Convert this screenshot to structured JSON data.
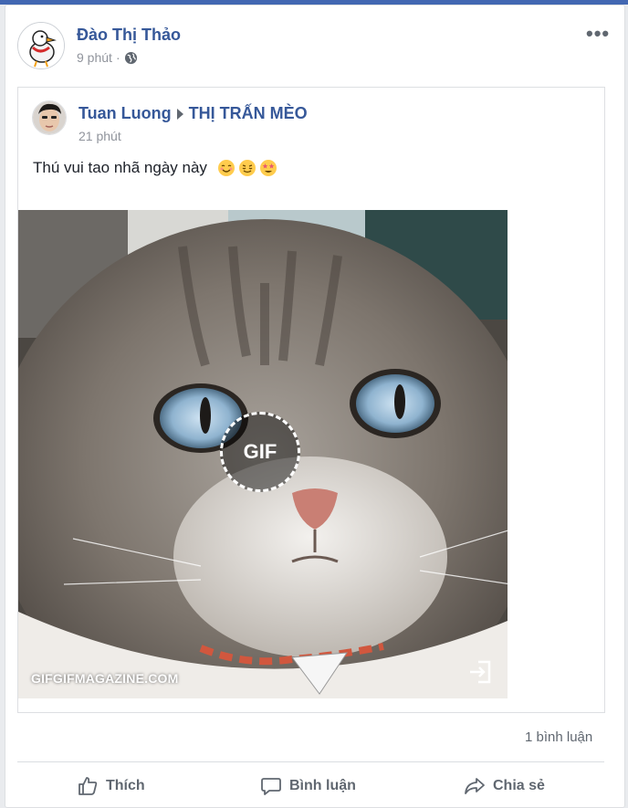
{
  "post": {
    "author": "Đào Thị Thảo",
    "time": "9 phút",
    "separator": "·",
    "more": "•••"
  },
  "shared_post": {
    "author": "Tuan Luong",
    "group": "THỊ TRẤN MÈO",
    "time": "21 phút",
    "caption": "Thú vui tao nhã ngày này",
    "emojis": [
      "smiling-face-icon",
      "relieved-face-icon",
      "star-struck-face-icon"
    ],
    "media": {
      "badge": "GIF",
      "watermark": "GIFGIFMAGAZINE.COM"
    }
  },
  "stats": {
    "comments": "1 bình luận"
  },
  "actions": {
    "like": "Thích",
    "comment": "Bình luận",
    "share": "Chia sẻ"
  },
  "colors": {
    "link": "#365899",
    "meta": "#90949c",
    "brand_bar": "#4267b2"
  }
}
